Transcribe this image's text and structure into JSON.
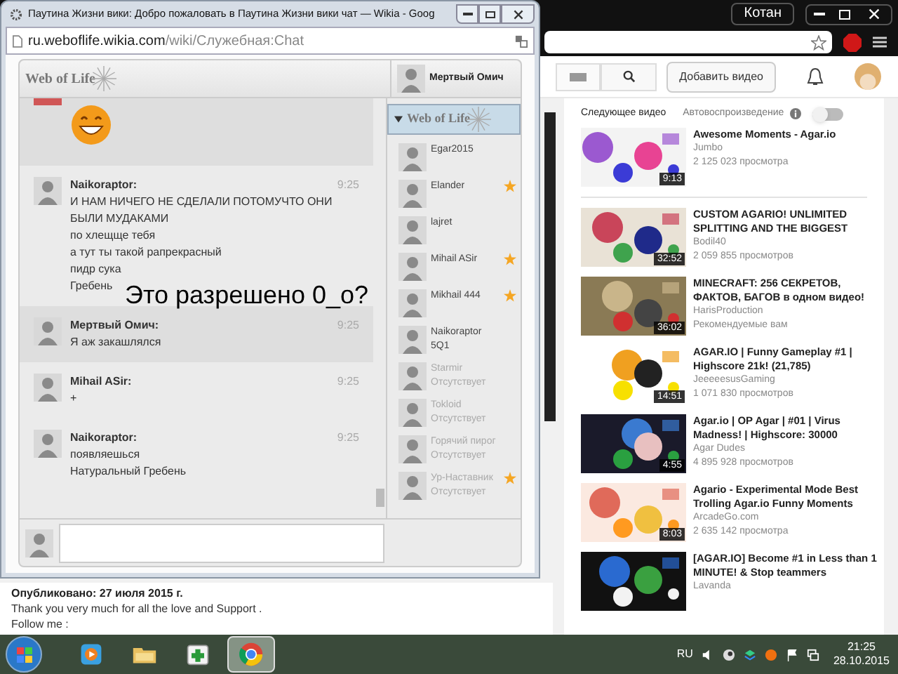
{
  "browser": {
    "profile": "Котан",
    "upload_button": "Добавить видео"
  },
  "sidebar": {
    "heading": "Следующее видео",
    "autoplay": {
      "label": "Автовоспроизведение",
      "on": false
    },
    "videos": [
      {
        "title": "Awesome Moments - Agar.io",
        "channel": "Jumbo",
        "meta": "2 125 023 просмотра",
        "duration": "9:13"
      },
      {
        "title": "CUSTOM AGARIO! UNLIMITED SPLITTING AND THE BIGGEST",
        "channel": "Bodil40",
        "meta": "2 059 855 просмотров",
        "duration": "32:52"
      },
      {
        "title": "MINECRAFT: 256 СЕКРЕТОВ, ФАКТОВ, БАГОВ в одном видео!",
        "channel": "HarisProduction",
        "meta": "Рекомендуемые вам",
        "duration": "36:02"
      },
      {
        "title": "AGAR.IO | Funny Gameplay #1 | Highscore 21k! (21,785)",
        "channel": "JeeeeesusGaming",
        "meta": "1 071 830 просмотров",
        "duration": "14:51"
      },
      {
        "title": "Agar.io | OP Agar | #01 | Virus Madness! | Highscore: 30000",
        "channel": "Agar Dudes",
        "meta": "4 895 928 просмотров",
        "duration": "4:55"
      },
      {
        "title": "Agario - Experimental Mode Best Trolling Agar.io Funny Moments",
        "channel": "ArcadeGo.com",
        "meta": "2 635 142 просмотра",
        "duration": "8:03"
      },
      {
        "title": "[AGAR.IO] Become #1 in Less than 1 MINUTE! & Stop teammers",
        "channel": "Lavanda"
      }
    ]
  },
  "description": {
    "published": "Опубликовано: 27 июля 2015 г.",
    "lines": [
      "Thank you very much for all the love and Support .",
      "Follow me :"
    ]
  },
  "chat_window": {
    "title": "Паутина Жизни вики: Добро пожаловать в Паутина Жизни вики чат — Wikia - Goog",
    "url_host": "ru.weboflife.wikia.com",
    "url_path": "/wiki/Служебная:Chat",
    "logo": "Web of Life",
    "current_user": "Мертвый Омич",
    "overlay_caption": "Это разрешено 0_o?",
    "messages": [
      {
        "kind": "emoji",
        "shaded": true
      },
      {
        "kind": "text",
        "shaded": false,
        "author": "Naikoraptor:",
        "time": "9:25",
        "lines": [
          "И НАМ НИЧЕГО НЕ СДЕЛАЛИ ПОТОМУЧТО ОНИ БЫЛИ МУДАКАМИ",
          "по хлещще тебя",
          "а тут ты такой рапрекрасный",
          "пидр сука",
          "Гребень"
        ]
      },
      {
        "kind": "text",
        "shaded": true,
        "author": "Мертвый Омич:",
        "time": "9:25",
        "lines": [
          "Я аж закашлялся"
        ]
      },
      {
        "kind": "text",
        "shaded": false,
        "author": "Mihail ASir:",
        "time": "9:25",
        "lines": [
          "+"
        ]
      },
      {
        "kind": "text",
        "shaded": false,
        "author": "Naikoraptor:",
        "time": "9:25",
        "lines": [
          "появляешься",
          "Натуральный Гребень"
        ]
      }
    ],
    "group": {
      "name": "Web of Life",
      "expanded": true
    },
    "users": [
      {
        "name": "Egar2015",
        "away": false,
        "star": false
      },
      {
        "name": "Elander",
        "away": false,
        "star": true
      },
      {
        "name": "lajret",
        "away": false,
        "star": false
      },
      {
        "name": "Mihail ASir",
        "away": false,
        "star": true
      },
      {
        "name": "Mikhail 444",
        "away": false,
        "star": true
      },
      {
        "name": "Naikoraptor",
        "status": "5Q1",
        "away": false,
        "star": false
      },
      {
        "name": "Starmir",
        "status": "Отсутствует",
        "away": true,
        "star": false
      },
      {
        "name": "Tokloid",
        "status": "Отсутствует",
        "away": true,
        "star": false
      },
      {
        "name": "Горячий пирог",
        "status": "Отсутствует",
        "away": true,
        "star": false
      },
      {
        "name": "Ур-Наставник",
        "status": "Отсутствует",
        "away": true,
        "star": true
      }
    ]
  },
  "taskbar": {
    "apps": [
      {
        "kind": "media",
        "active": false
      },
      {
        "kind": "folder",
        "active": false
      },
      {
        "kind": "plus",
        "active": false
      },
      {
        "kind": "browser",
        "active": true
      }
    ],
    "language": "RU",
    "time": "21:25",
    "date": "28.10.2015"
  }
}
